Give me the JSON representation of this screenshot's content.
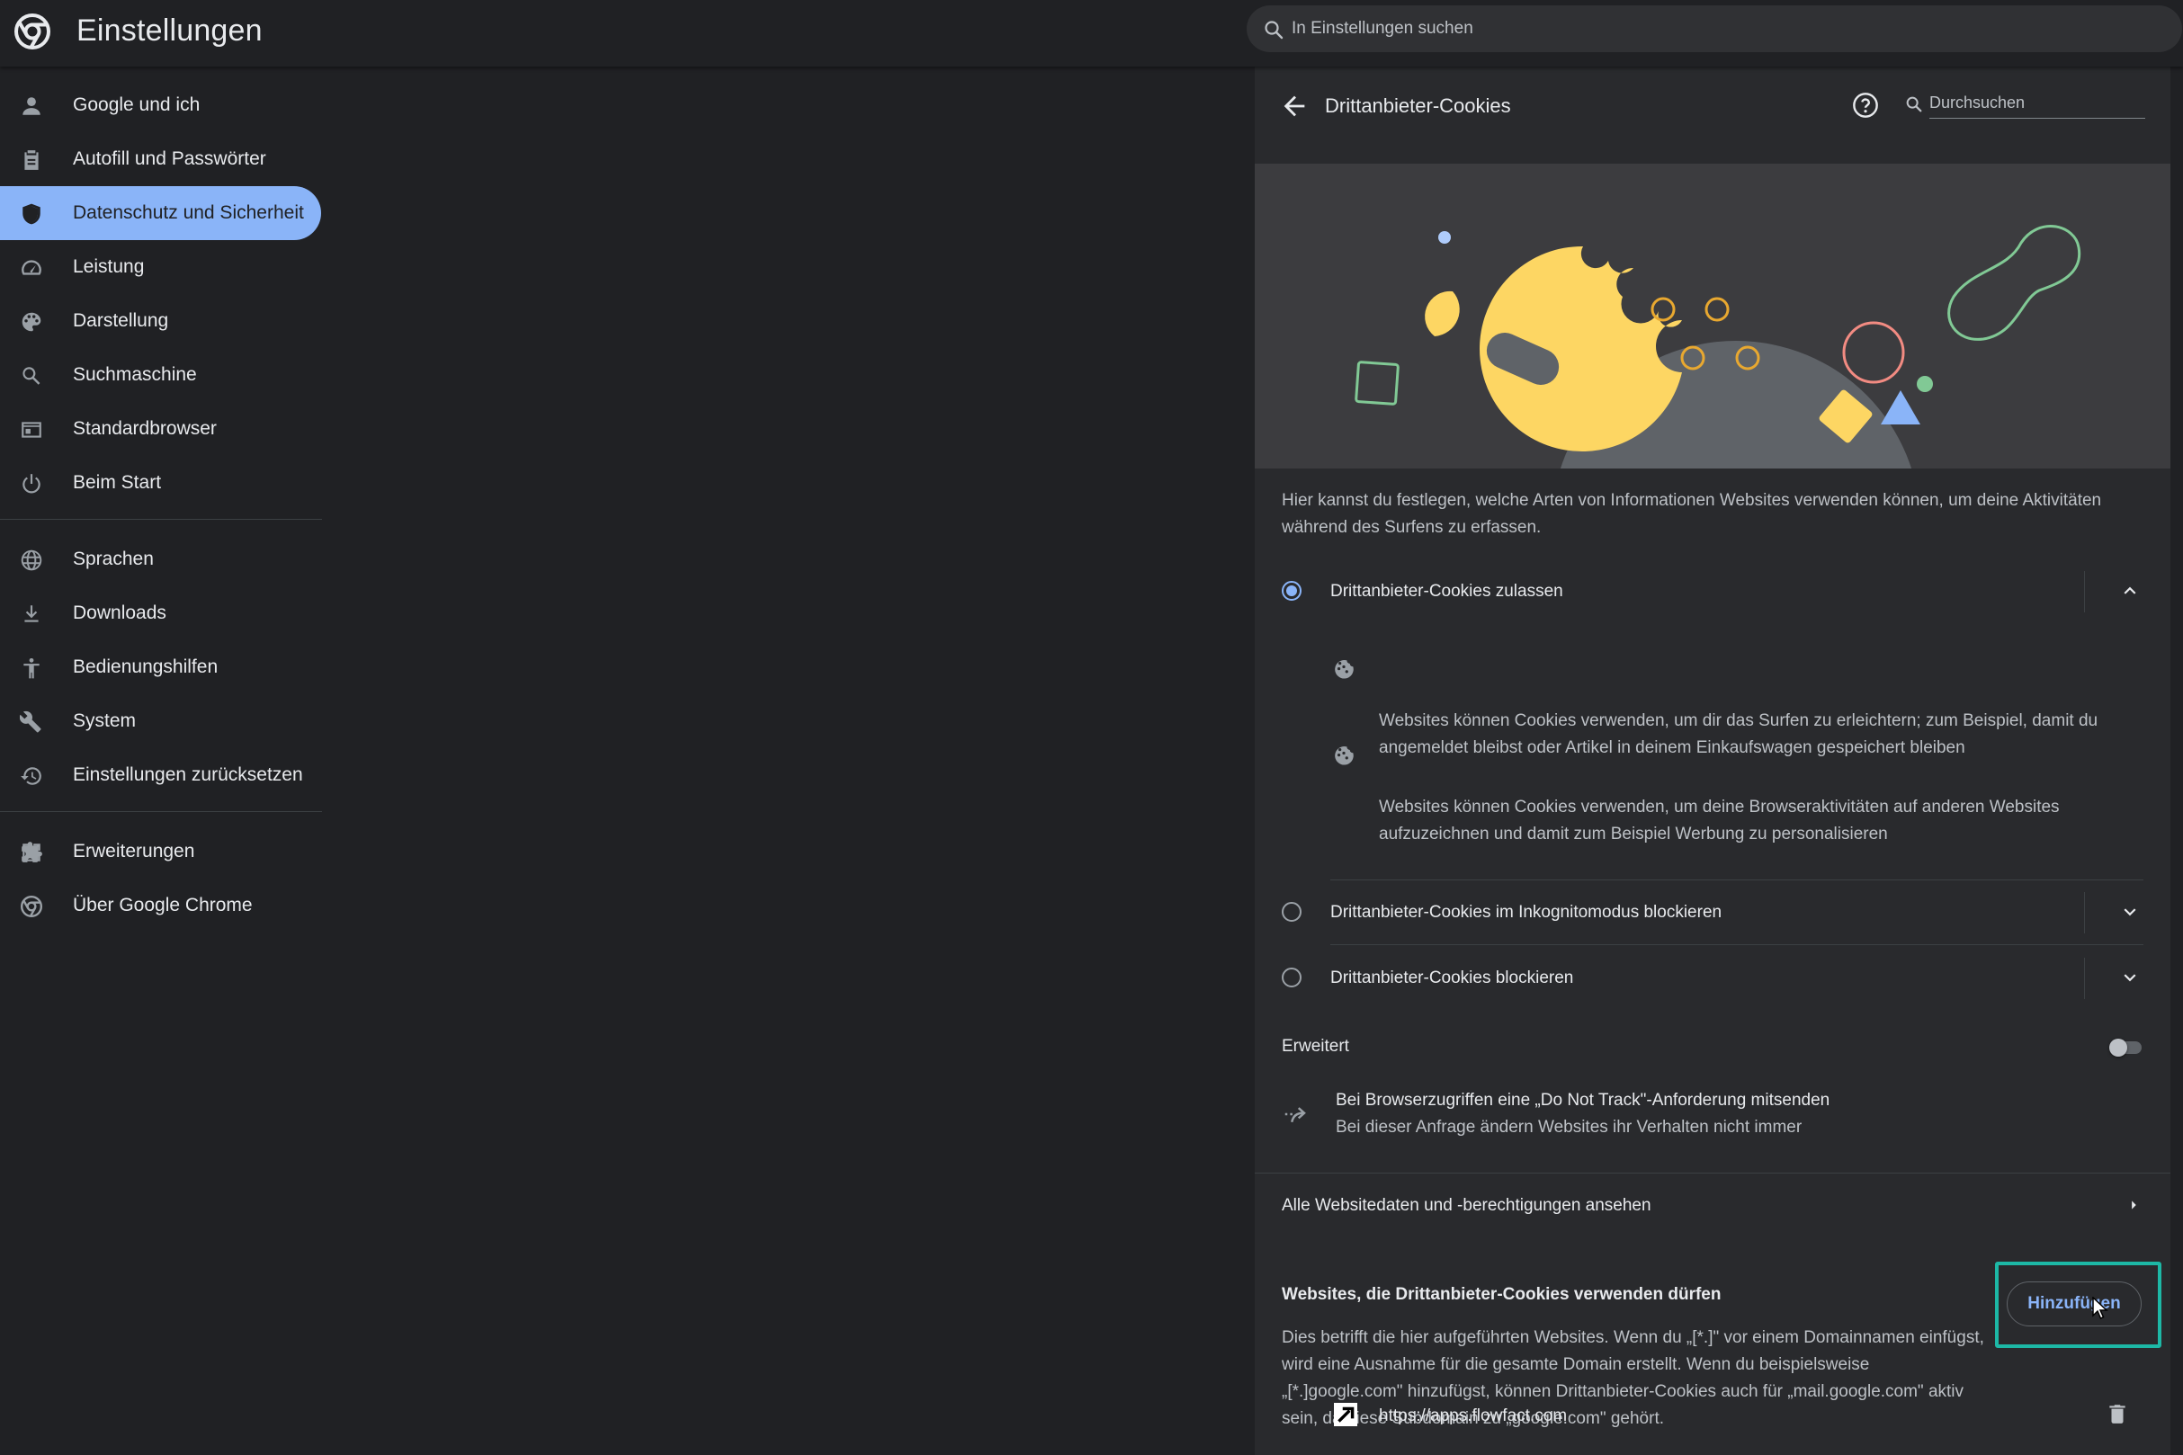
{
  "app": {
    "title": "Einstellungen"
  },
  "search": {
    "placeholder": "In Einstellungen suchen"
  },
  "sidebar": {
    "items": [
      {
        "label": "Google und ich",
        "icon": "person-icon"
      },
      {
        "label": "Autofill und Passwörter",
        "icon": "clipboard-icon"
      },
      {
        "label": "Datenschutz und Sicherheit",
        "icon": "shield-icon",
        "active": true
      },
      {
        "label": "Leistung",
        "icon": "speedometer-icon"
      },
      {
        "label": "Darstellung",
        "icon": "palette-icon"
      },
      {
        "label": "Suchmaschine",
        "icon": "search-icon"
      },
      {
        "label": "Standardbrowser",
        "icon": "browser-window-icon"
      },
      {
        "label": "Beim Start",
        "icon": "power-icon"
      },
      {
        "label": "Sprachen",
        "icon": "globe-icon"
      },
      {
        "label": "Downloads",
        "icon": "download-icon"
      },
      {
        "label": "Bedienungshilfen",
        "icon": "accessibility-icon"
      },
      {
        "label": "System",
        "icon": "wrench-icon"
      },
      {
        "label": "Einstellungen zurücksetzen",
        "icon": "restore-icon"
      },
      {
        "label": "Erweiterungen",
        "icon": "puzzle-icon"
      },
      {
        "label": "Über Google Chrome",
        "icon": "chrome-logo-icon"
      }
    ]
  },
  "panel": {
    "title": "Drittanbieter-Cookies",
    "search_placeholder": "Durchsuchen",
    "description": "Hier kannst du festlegen, welche Arten von Informationen Websites verwenden können, um deine Aktivitäten während des Surfens zu erfassen.",
    "options": [
      {
        "label": "Drittanbieter-Cookies zulassen",
        "selected": true,
        "expanded": true,
        "details": [
          "Websites können Cookies verwenden, um dir das Surfen zu erleichtern; zum Beispiel, damit du angemeldet bleibst oder Artikel in deinem Einkaufswagen gespeichert bleiben",
          "Websites können Cookies verwenden, um deine Browseraktivitäten auf anderen Websites aufzuzeichnen und damit zum Beispiel Werbung zu personalisieren"
        ]
      },
      {
        "label": "Drittanbieter-Cookies im Inkognitomodus blockieren",
        "selected": false
      },
      {
        "label": "Drittanbieter-Cookies blockieren",
        "selected": false
      }
    ],
    "advanced": {
      "heading": "Erweitert",
      "dnt_title": "Bei Browserzugriffen eine „Do Not Track\"-Anforderung mitsenden",
      "dnt_subtitle": "Bei dieser Anfrage ändern Websites ihr Verhalten nicht immer",
      "dnt_enabled": false
    },
    "all_sites_link": "Alle Websitedaten und -berechtigungen ansehen",
    "allowed": {
      "heading": "Websites, die Drittanbieter-Cookies verwenden dürfen",
      "description": "Dies betrifft die hier aufgeführten Websites. Wenn du „[*.]\" vor einem Domainnamen einfügst, wird eine Ausnahme für die gesamte Domain erstellt. Wenn du beispielsweise „[*.]google.com\" hinzufügst, können Drittanbieter-Cookies auch für „mail.google.com\" aktiv sein, da diese Subdomain zu „google.com\" gehört.",
      "add_button": "Hinzufügen",
      "sites": [
        {
          "url": "https://apps.flowfact.com"
        }
      ]
    }
  },
  "colors": {
    "background": "#202124",
    "panel": "#292a2d",
    "accent": "#8ab4f8",
    "highlight": "#1db8a6",
    "cookie": "#fdd663"
  }
}
